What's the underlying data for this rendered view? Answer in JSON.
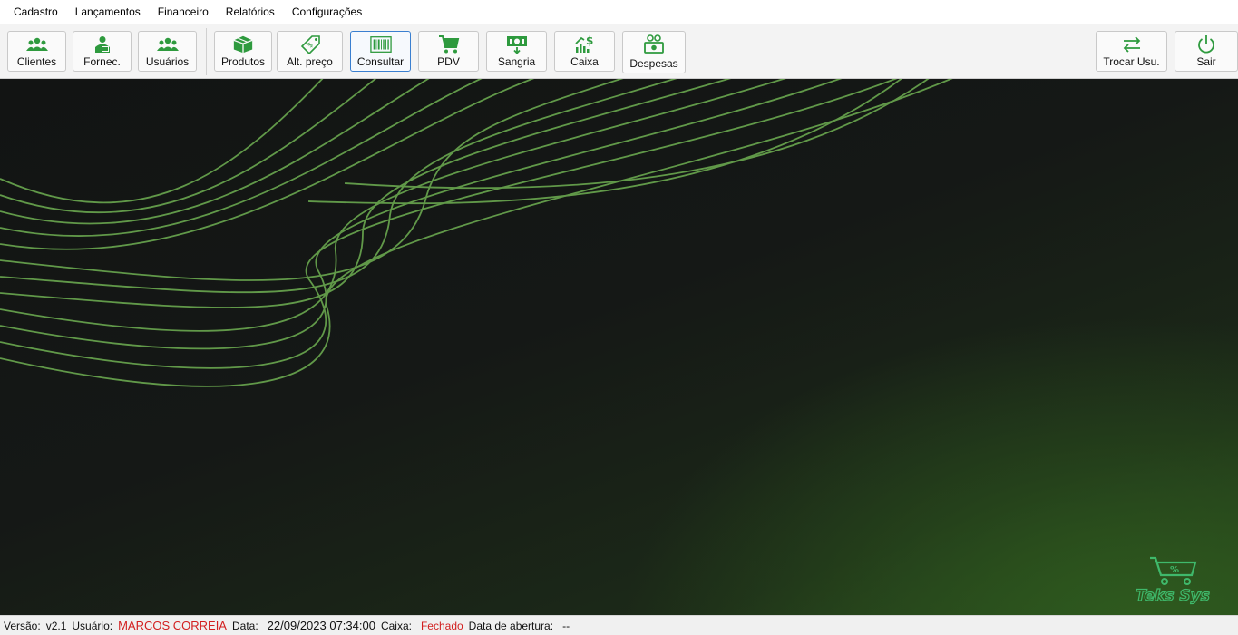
{
  "menu": [
    "Cadastro",
    "Lançamentos",
    "Financeiro",
    "Relatórios",
    "Configurações"
  ],
  "toolbar": {
    "clientes": "Clientes",
    "fornec": "Fornec.",
    "usuarios": "Usuários",
    "produtos": "Produtos",
    "alt_preco": "Alt. preço",
    "consultar": "Consultar",
    "pdv": "PDV",
    "sangria": "Sangria",
    "caixa": "Caixa",
    "despesas": "Despesas",
    "trocar_usu": "Trocar Usu.",
    "sair": "Sair"
  },
  "icons": {
    "clientes": "users-group-icon",
    "fornec": "supplier-id-icon",
    "usuarios": "users-group-icon",
    "produtos": "box-icon",
    "alt_preco": "price-tag-icon",
    "consultar": "barcode-icon",
    "pdv": "shopping-cart-icon",
    "sangria": "cash-withdraw-icon",
    "caixa": "cash-chart-icon",
    "despesas": "expenses-icon",
    "trocar_usu": "swap-arrows-icon",
    "sair": "power-icon"
  },
  "logo": {
    "text": "Teks Sys"
  },
  "status": {
    "versao_label": "Versão:",
    "versao_value": "v2.1",
    "usuario_label": "Usuário:",
    "usuario_value": "MARCOS CORREIA",
    "data_label": "Data:",
    "data_value": "22/09/2023 07:34:00",
    "caixa_label": "Caixa:",
    "caixa_value": "Fechado",
    "abertura_label": "Data de abertura:",
    "abertura_value": "--"
  },
  "colors": {
    "accent": "#2e9a3e",
    "status_red": "#d21f1f",
    "wave": "#6aa84f",
    "selected_border": "#3a7fd0"
  }
}
